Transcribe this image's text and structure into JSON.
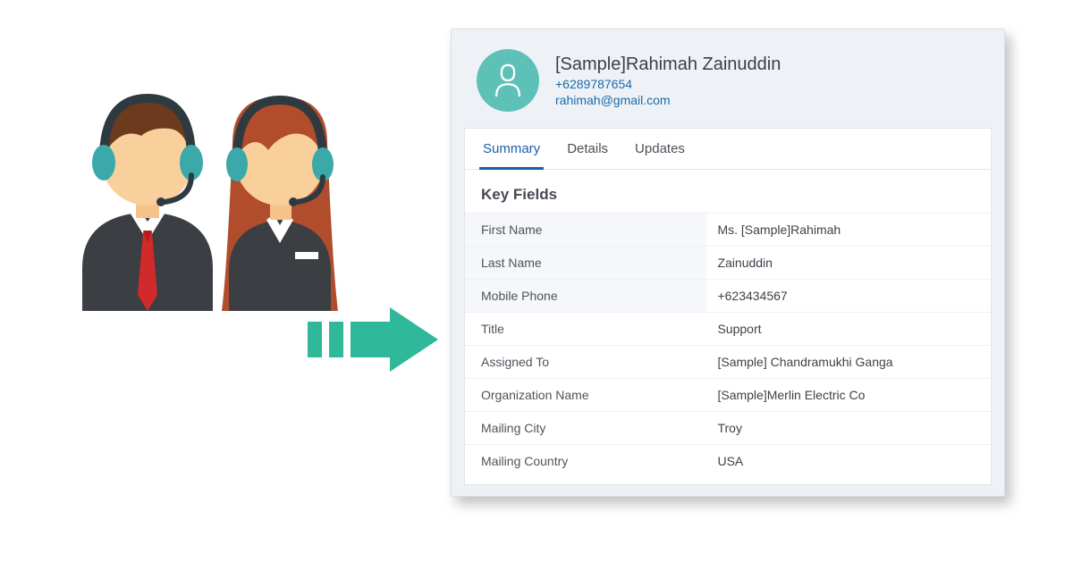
{
  "contact": {
    "name": "[Sample]Rahimah Zainuddin",
    "phone": "+6289787654",
    "email": "rahimah@gmail.com"
  },
  "tabs": {
    "summary": "Summary",
    "details": "Details",
    "updates": "Updates"
  },
  "section_title": "Key Fields",
  "fields": {
    "first_name": {
      "label": "First Name",
      "value": "Ms. [Sample]Rahimah"
    },
    "last_name": {
      "label": "Last Name",
      "value": "Zainuddin"
    },
    "mobile_phone": {
      "label": "Mobile Phone",
      "value": "+623434567"
    },
    "title": {
      "label": "Title",
      "value": "Support"
    },
    "assigned_to": {
      "label": "Assigned To",
      "value": "[Sample] Chandramukhi Ganga"
    },
    "organization": {
      "label": "Organization Name",
      "value": "[Sample]Merlin Electric Co"
    },
    "mailing_city": {
      "label": "Mailing City",
      "value": "Troy"
    },
    "mailing_country": {
      "label": "Mailing Country",
      "value": "USA"
    }
  }
}
